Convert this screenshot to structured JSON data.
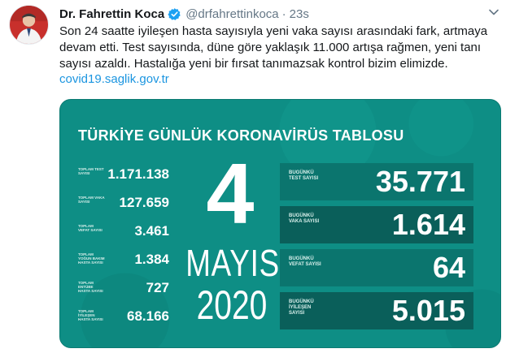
{
  "tweet": {
    "display_name": "Dr. Fahrettin Koca",
    "handle": "@drfahrettinkoca",
    "separator": "·",
    "time": "23s",
    "text_lines": [
      "Son 24 saatte iyileşen hasta sayısıyla yeni vaka sayısı arasındaki fark, artmaya",
      "devam etti. Test sayısında, düne göre yaklaşık 11.000 artışa rağmen, yeni tanı",
      "sayısı azaldı. Hastalığa yeni bir fırsat tanımazsak kontrol bizim elimizde."
    ],
    "link": "covid19.saglik.gov.tr"
  },
  "card": {
    "title": "TÜRKİYE GÜNLÜK KORONAVİRÜS TABLOSU",
    "left_stats": [
      {
        "label": "TOPLAM TEST SAYISI",
        "value": "1.171.138"
      },
      {
        "label": "TOPLAM VAKA SAYISI",
        "value": "127.659"
      },
      {
        "label": "TOPLAM VEFAT SAYISI",
        "value": "3.461"
      },
      {
        "label": "TOPLAM YOĞUN BAKIM HASTA SAYISI",
        "value": "1.384"
      },
      {
        "label": "TOPLAM ENTÜBE HASTA SAYISI",
        "value": "727"
      },
      {
        "label": "TOPLAM İYİLEŞEN HASTA SAYISI",
        "value": "68.166"
      }
    ],
    "day": "4",
    "month": "MAYIS",
    "year": "2020",
    "daily": [
      {
        "label": "BUGÜNKÜ TEST SAYISI",
        "value": "35.771"
      },
      {
        "label": "BUGÜNKÜ VAKA SAYISI",
        "value": "1.614"
      },
      {
        "label": "BUGÜNKÜ VEFAT SAYISI",
        "value": "64"
      },
      {
        "label": "BUGÜNKÜ İYİLEŞEN SAYISI",
        "value": "5.015"
      }
    ]
  },
  "colors": {
    "card_bg": "#0e8e85",
    "box_bg": "#0b756e",
    "box_dark_bg": "#0a5f5a",
    "link": "#1b95e0",
    "verified": "#1da1f2"
  },
  "icons": [
    "avatar",
    "verified-badge-icon",
    "chevron-down-icon"
  ]
}
